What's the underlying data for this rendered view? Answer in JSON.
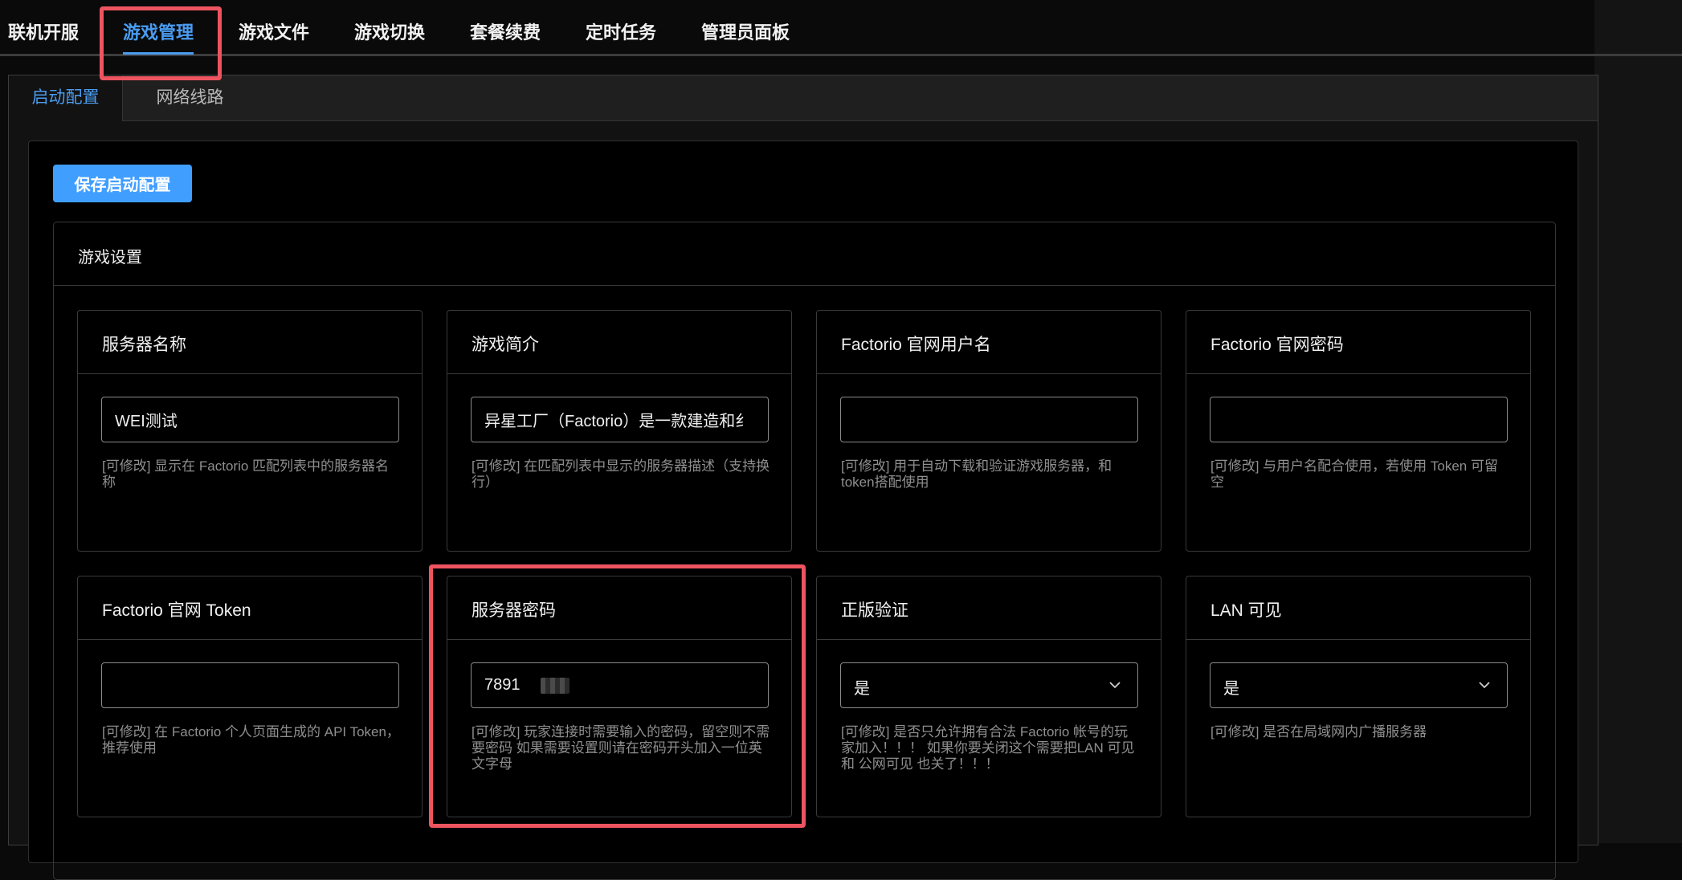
{
  "nav": {
    "tabs": [
      "联机开服",
      "游戏管理",
      "游戏文件",
      "游戏切换",
      "套餐续费",
      "定时任务",
      "管理员面板"
    ],
    "active": "游戏管理"
  },
  "subtabs": {
    "config": "启动配置",
    "network": "网络线路"
  },
  "save_button": "保存启动配置",
  "section_title": "游戏设置",
  "cards": [
    {
      "title": "服务器名称",
      "type": "text",
      "value": "WEI测试",
      "help": "[可修改] 显示在 Factorio 匹配列表中的服务器名称"
    },
    {
      "title": "游戏简介",
      "type": "text",
      "value": "异星工厂（Factorio）是一款建造和纟",
      "help": "[可修改] 在匹配列表中显示的服务器描述（支持换行）"
    },
    {
      "title": "Factorio 官网用户名",
      "type": "text",
      "value": "",
      "help": "[可修改] 用于自动下载和验证游戏服务器，和token搭配使用"
    },
    {
      "title": "Factorio 官网密码",
      "type": "text",
      "value": "",
      "help": "[可修改] 与用户名配合使用，若使用 Token 可留空"
    },
    {
      "title": "Factorio 官网 Token",
      "type": "text",
      "value": "",
      "help": "[可修改] 在 Factorio 个人页面生成的 API Token，推荐使用"
    },
    {
      "title": "服务器密码",
      "type": "password",
      "value": "7891",
      "help": "[可修改] 玩家连接时需要输入的密码，留空则不需要密码 如果需要设置则请在密码开头加入一位英文字母"
    },
    {
      "title": "正版验证",
      "type": "select",
      "value": "是",
      "help": "[可修改] 是否只允许拥有合法 Factorio 帐号的玩家加入！！！ 如果你要关闭这个需要把LAN 可见 和 公网可见 也关了！！！"
    },
    {
      "title": "LAN 可见",
      "type": "select",
      "value": "是",
      "help": "[可修改] 是否在局域网内广播服务器"
    }
  ],
  "colors": {
    "accent": "#409eff",
    "highlight": "#ee5460",
    "background": "#000000"
  }
}
